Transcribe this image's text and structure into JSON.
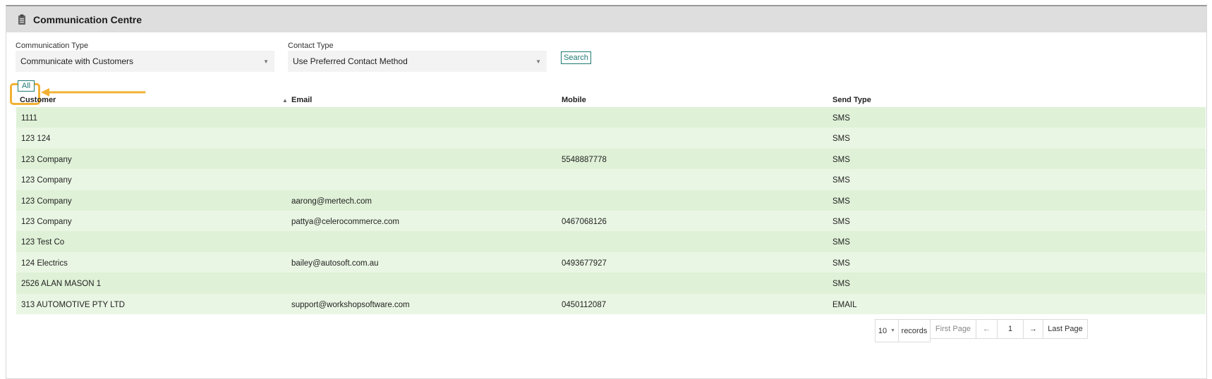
{
  "header": {
    "title": "Communication Centre"
  },
  "filters": {
    "communication_type_label": "Communication Type",
    "communication_type_value": "Communicate with Customers",
    "contact_type_label": "Contact Type",
    "contact_type_value": "Use Preferred Contact Method",
    "search_label": "Search"
  },
  "all_button_label": "All",
  "table": {
    "headers": {
      "customer": "Customer",
      "email": "Email",
      "mobile": "Mobile",
      "send_type": "Send Type"
    },
    "rows": [
      {
        "customer": "1111",
        "email": "",
        "mobile": "",
        "send_type": "SMS"
      },
      {
        "customer": "123 124",
        "email": "",
        "mobile": "",
        "send_type": "SMS"
      },
      {
        "customer": "123 Company",
        "email": "",
        "mobile": "5548887778",
        "send_type": "SMS"
      },
      {
        "customer": "123 Company",
        "email": "",
        "mobile": "",
        "send_type": "SMS"
      },
      {
        "customer": "123 Company",
        "email": "aarong@mertech.com",
        "mobile": "",
        "send_type": "SMS"
      },
      {
        "customer": "123 Company",
        "email": "pattya@celerocommerce.com",
        "mobile": "0467068126",
        "send_type": "SMS"
      },
      {
        "customer": "123 Test Co",
        "email": "",
        "mobile": "",
        "send_type": "SMS"
      },
      {
        "customer": "124 Electrics",
        "email": "bailey@autosoft.com.au",
        "mobile": "0493677927",
        "send_type": "SMS"
      },
      {
        "customer": "2526 ALAN MASON 1",
        "email": "",
        "mobile": "",
        "send_type": "SMS"
      },
      {
        "customer": "313 AUTOMOTIVE PTY LTD",
        "email": "support@workshopsoftware.com",
        "mobile": "0450112087",
        "send_type": "EMAIL"
      }
    ]
  },
  "pager": {
    "page_size": "10",
    "records_label": "records",
    "first_page": "First Page",
    "prev_arrow": "←",
    "current_page": "1",
    "next_arrow": "→",
    "last_page": "Last Page"
  },
  "colors": {
    "accent": "#1f7a73",
    "highlight": "#f2b134",
    "row_odd": "#dff1d7",
    "row_even": "#eaf6e4"
  }
}
